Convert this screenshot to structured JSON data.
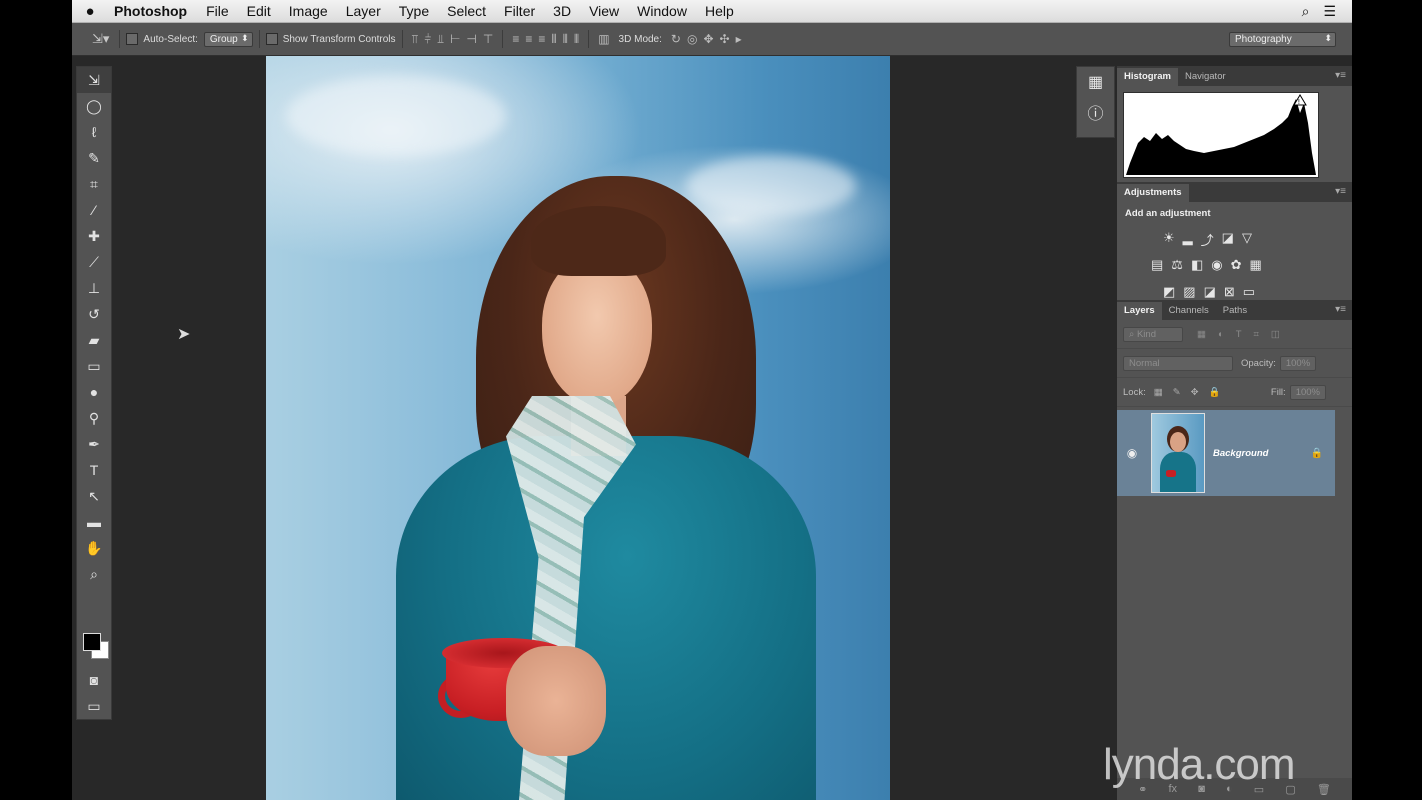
{
  "menubar": {
    "apple": "",
    "app_name": "Photoshop",
    "items": [
      "File",
      "Edit",
      "Image",
      "Layer",
      "Type",
      "Select",
      "Filter",
      "3D",
      "View",
      "Window",
      "Help"
    ]
  },
  "options": {
    "auto_select_label": "Auto-Select:",
    "auto_select_value": "Group",
    "transform_label": "Show Transform Controls",
    "mode_3d_label": "3D Mode:",
    "workspace": "Photography"
  },
  "panels": {
    "histogram_tab": "Histogram",
    "navigator_tab": "Navigator",
    "adjustments_tab": "Adjustments",
    "add_adjustment": "Add an adjustment",
    "layers_tab": "Layers",
    "channels_tab": "Channels",
    "paths_tab": "Paths",
    "kind_filter": "Kind",
    "blend_mode": "Normal",
    "opacity_label": "Opacity:",
    "opacity_value": "100%",
    "lock_label": "Lock:",
    "fill_label": "Fill:",
    "fill_value": "100%",
    "layer_name": "Background"
  },
  "watermark": "lynda.com"
}
